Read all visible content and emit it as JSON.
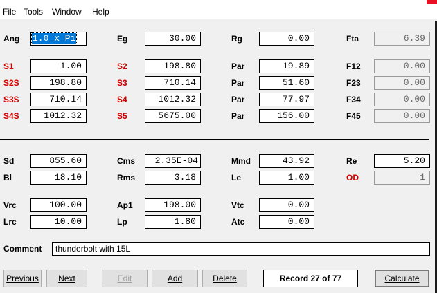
{
  "menu": [
    "File",
    "Tools",
    "Window",
    "Help"
  ],
  "labels": {
    "ang": "Ang",
    "eg": "Eg",
    "rg": "Rg",
    "fta": "Fta",
    "s1": "S1",
    "s2": "S2",
    "par1": "Par",
    "f12": "F12",
    "s2s": "S2S",
    "s3": "S3",
    "par2": "Par",
    "f23": "F23",
    "s3s": "S3S",
    "s4": "S4",
    "par3": "Par",
    "f34": "F34",
    "s4s": "S4S",
    "s5": "S5",
    "par4": "Par",
    "f45": "F45",
    "sd": "Sd",
    "cms": "Cms",
    "mmd": "Mmd",
    "re": "Re",
    "bl": "Bl",
    "rms": "Rms",
    "le": "Le",
    "od": "OD",
    "vrc": "Vrc",
    "ap1": "Ap1",
    "vtc": "Vtc",
    "lrc": "Lrc",
    "lp": "Lp",
    "atc": "Atc",
    "comment": "Comment"
  },
  "values": {
    "ang": "1.0 x Pi",
    "eg": "30.00",
    "rg": "0.00",
    "fta": "6.39",
    "s1": "1.00",
    "s2": "198.80",
    "par1": "19.89",
    "f12": "0.00",
    "s2s": "198.80",
    "s3": "710.14",
    "par2": "51.60",
    "f23": "0.00",
    "s3s": "710.14",
    "s4": "1012.32",
    "par3": "77.97",
    "f34": "0.00",
    "s4s": "1012.32",
    "s5": "5675.00",
    "par4": "156.00",
    "f45": "0.00",
    "sd": "855.60",
    "cms": "2.35E-04",
    "mmd": "43.92",
    "re": "5.20",
    "bl": "18.10",
    "rms": "3.18",
    "le": "1.00",
    "od": "1",
    "vrc": "100.00",
    "ap1": "198.00",
    "vtc": "0.00",
    "lrc": "10.00",
    "lp": "1.80",
    "atc": "0.00",
    "comment": "thunderbolt with 15L"
  },
  "buttons": {
    "previous": "Previous",
    "next": "Next",
    "edit": "Edit",
    "add": "Add",
    "delete": "Delete",
    "calculate": "Calculate"
  },
  "record": "Record 27 of 77",
  "colors": {
    "red_label": "#d00000",
    "selection": "#0078d7"
  }
}
